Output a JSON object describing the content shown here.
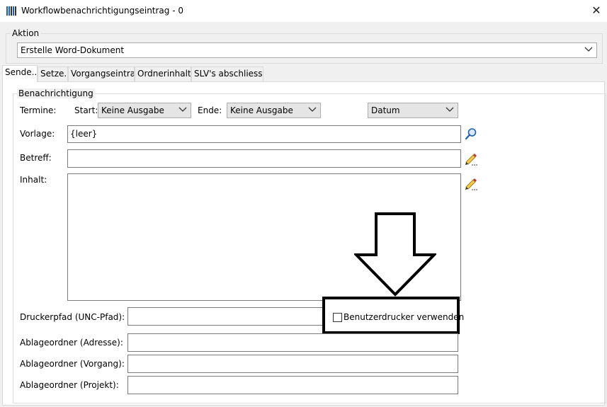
{
  "window": {
    "title": "Workflowbenachrichtigungseintrag - 0",
    "close_glyph": "✕"
  },
  "aktion": {
    "legend": "Aktion",
    "selected": "Erstelle Word-Dokument"
  },
  "tabs": [
    {
      "label": "Sende..."
    },
    {
      "label": "Setze..."
    },
    {
      "label": "Vorgangseintrag"
    },
    {
      "label": "Ordnerinhalte"
    },
    {
      "label": "SLV's abschliessen"
    }
  ],
  "benachrichtigung": {
    "legend": "Benachrichtigung",
    "termine_label": "Termine:",
    "start_label": "Start:",
    "start_value": "Keine Ausgabe",
    "ende_label": "Ende:",
    "ende_value": "Keine Ausgabe",
    "datum_value": "Datum",
    "vorlage_label": "Vorlage:",
    "vorlage_value": "{leer}",
    "betreff_label": "Betreff:",
    "betreff_value": "",
    "inhalt_label": "Inhalt:",
    "inhalt_value": "",
    "druckerpfad_label": "Druckerpfad (UNC-Pfad):",
    "druckerpfad_value": "",
    "benutzerdrucker_label": "Benutzerdrucker verwenden",
    "benutzerdrucker_checked": false,
    "ablage_adresse_label": "Ablageordner (Adresse):",
    "ablage_vorgang_label": "Ablageordner (Vorgang):",
    "ablage_projekt_label": "Ablageordner (Projekt):"
  },
  "colors": {
    "accent_icon": "#1a5fb4",
    "annotation": "#000000"
  },
  "icons": [
    "app-icon",
    "close-icon",
    "chevron-down-icon",
    "search-icon",
    "pencil-icon",
    "arrow-down-annotation"
  ]
}
